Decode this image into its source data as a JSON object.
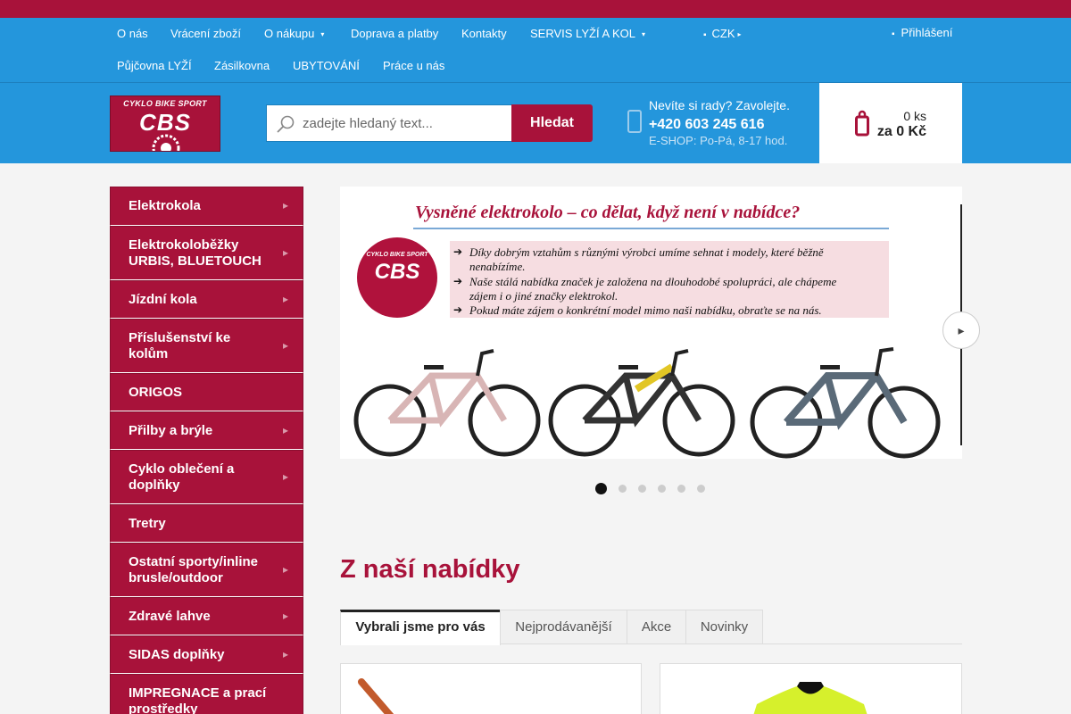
{
  "top_nav": {
    "row1": [
      {
        "label": "O nás"
      },
      {
        "label": "Vrácení zboží"
      },
      {
        "label": "O nákupu",
        "has_dropdown": true
      },
      {
        "label": "Doprava a platby"
      },
      {
        "label": "Kontakty"
      },
      {
        "label": "SERVIS LYŽÍ A KOL",
        "has_dropdown": true
      }
    ],
    "row2": [
      {
        "label": "Půjčovna LYŽÍ"
      },
      {
        "label": "Zásilkovna"
      },
      {
        "label": "UBYTOVÁNÍ"
      },
      {
        "label": "Práce u nás"
      }
    ],
    "currency": "CZK",
    "login": "Přihlášení"
  },
  "logo": {
    "line1": "CYKLO BIKE SPORT",
    "line2": "CBS"
  },
  "search": {
    "placeholder": "zadejte hledaný text...",
    "button": "Hledat"
  },
  "contact": {
    "question": "Nevíte si rady? Zavolejte.",
    "phone": "+420 603 245 616",
    "hours": "E-SHOP: Po-Pá, 8-17 hod."
  },
  "cart": {
    "count": "0 ks",
    "total": "za 0 Kč"
  },
  "categories": [
    {
      "label": "Elektrokola",
      "has_arrow": true
    },
    {
      "label": "Elektrokoloběžky URBIS, BLUETOUCH",
      "has_arrow": true
    },
    {
      "label": "Jízdní kola",
      "has_arrow": true
    },
    {
      "label": "Příslušenství ke kolům",
      "has_arrow": true
    },
    {
      "label": "ORIGOS",
      "has_arrow": false
    },
    {
      "label": "Přilby a brýle",
      "has_arrow": true
    },
    {
      "label": "Cyklo oblečení a doplňky",
      "has_arrow": true
    },
    {
      "label": "Tretry",
      "has_arrow": false
    },
    {
      "label": "Ostatní sporty/inline brusle/outdoor",
      "has_arrow": true
    },
    {
      "label": "Zdravé lahve",
      "has_arrow": true
    },
    {
      "label": "SIDAS doplňky",
      "has_arrow": true
    },
    {
      "label": "IMPREGNACE a prací prostředky",
      "has_arrow": false
    }
  ],
  "banner": {
    "title": "Vysněné elektrokolo – co dělat, když není v nabídce?",
    "logo_line1": "CYKLO BIKE SPORT",
    "logo_line2": "CBS",
    "lines": [
      "Díky dobrým vztahům s různými výrobci umíme sehnat i modely, které běžně",
      "nenabízíme.",
      "Naše stálá nabídka značek je založena na dlouhodobé spolupráci, ale chápeme",
      "zájem i o jiné značky elektrokol.",
      "Pokud máte zájem o konkrétní model mimo naši nabídku, obraťte se na nás."
    ],
    "bike_colors": [
      "#d8b5b5",
      "#e2c625",
      "#5a6a78"
    ]
  },
  "carousel": {
    "slide_count": 6,
    "active_index": 0
  },
  "offer": {
    "title": "Z naší nabídky",
    "tabs": [
      "Vybrali jsme pro vás",
      "Nejprodávanější",
      "Akce",
      "Novinky"
    ],
    "active_tab": 0
  },
  "colors": {
    "brand_red": "#a8123a",
    "nav_blue": "#2496dc",
    "page_bg": "#f4f4f4"
  }
}
